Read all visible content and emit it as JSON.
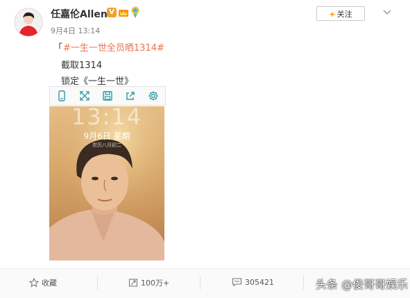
{
  "user": {
    "name": "任嘉伦Allen",
    "verified_mark": "V",
    "post_time": "9月4日 13:14"
  },
  "follow_button": {
    "label": "关注",
    "plus": "+"
  },
  "post": {
    "hashtag_bracket": "「",
    "hashtag": "#一生一世全员晒1314#",
    "line1": "截取1314",
    "line2": "锁定《一生一世》"
  },
  "image_toolbar": {
    "icons": [
      "phone-icon",
      "expand-icon",
      "save-icon",
      "share-icon",
      "settings-icon"
    ]
  },
  "lockscreen": {
    "time": "13:14",
    "date": "9月6日 星期",
    "lunar": "农历八月初二"
  },
  "footer": {
    "favorite_label": "收藏",
    "repost_count": "100万+",
    "comment_count": "305421"
  },
  "watermark": "头条 @俊哥哥娱乐",
  "colors": {
    "hashtag": "#eb7350",
    "follow_plus": "#ff8200",
    "verified": "#f1a12b"
  }
}
